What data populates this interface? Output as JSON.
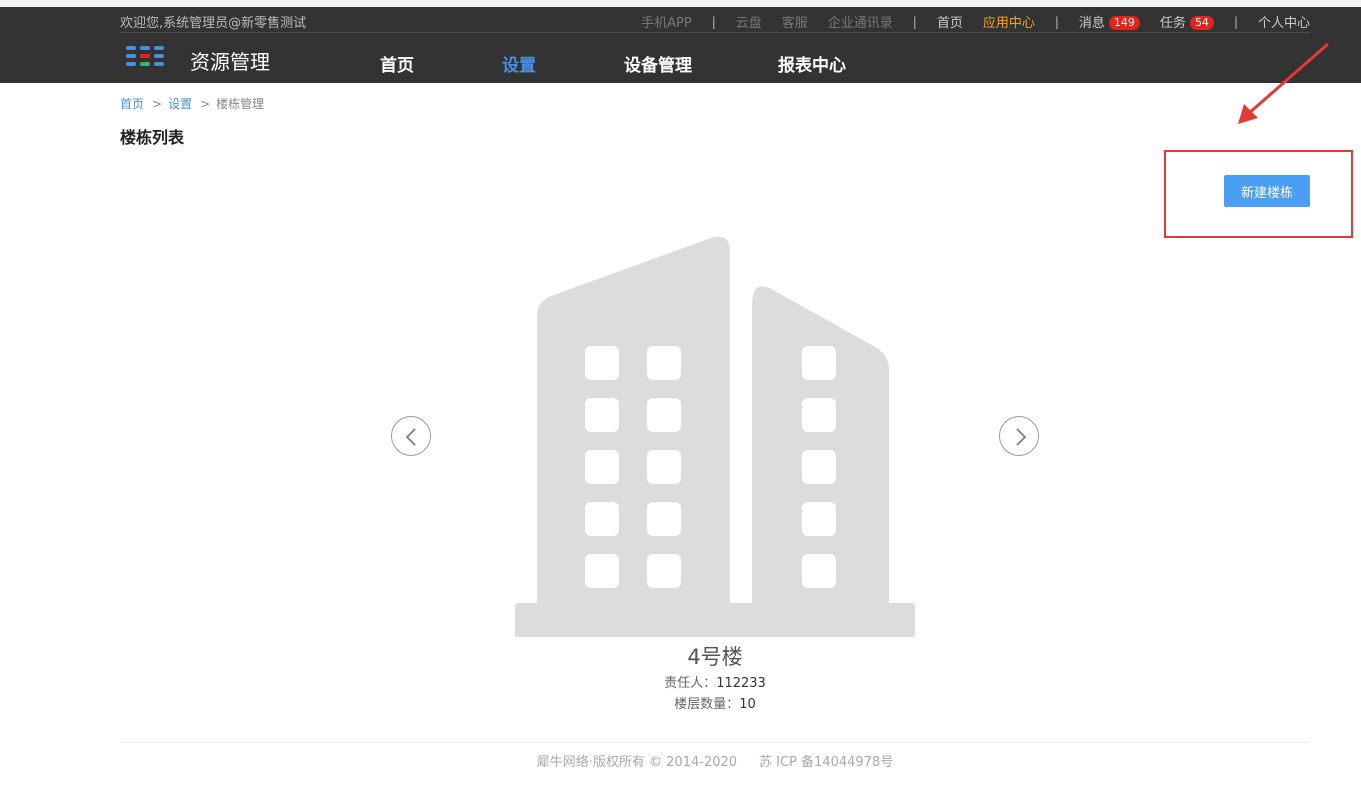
{
  "topbar": {
    "welcome": "欢迎您,系统管理员@新零售测试",
    "links": {
      "mobile_app": "手机APP",
      "cloud_disk": "云盘",
      "customer_service": "客服",
      "contacts": "企业通讯录",
      "home": "首页",
      "app_center": "应用中心",
      "messages": "消息",
      "messages_count": "149",
      "tasks": "任务",
      "tasks_count": "54",
      "personal_center": "个人中心"
    },
    "separator": "|"
  },
  "brand": {
    "title": "资源管理",
    "logo_icon": "app-grid-icon"
  },
  "nav": {
    "home": "首页",
    "settings": "设置",
    "devices": "设备管理",
    "reports": "报表中心",
    "active": "settings"
  },
  "breadcrumb": {
    "home": "首页",
    "settings": "设置",
    "current": "楼栋管理",
    "separator": ">"
  },
  "page_title": "楼栋列表",
  "actions": {
    "new_building": "新建楼栋"
  },
  "carousel": {
    "prev_icon": "chevron-left-icon",
    "next_icon": "chevron-right-icon",
    "item": {
      "image_icon": "building-icon",
      "name": "4号楼",
      "owner_label": "责任人：",
      "owner_value": "112233",
      "floors_label": "楼层数量：",
      "floors_value": "10"
    }
  },
  "footer": {
    "copyright": "犀牛网络·版权所有 © 2014-2020",
    "icp": "苏 ICP 备14044978号"
  },
  "colors": {
    "header_bg": "#333333",
    "accent_blue": "#4a90e2",
    "button_blue": "#4a9ff5",
    "orange": "#f5a623",
    "badge_red": "#e3241b",
    "annotation_red": "#e53935"
  }
}
